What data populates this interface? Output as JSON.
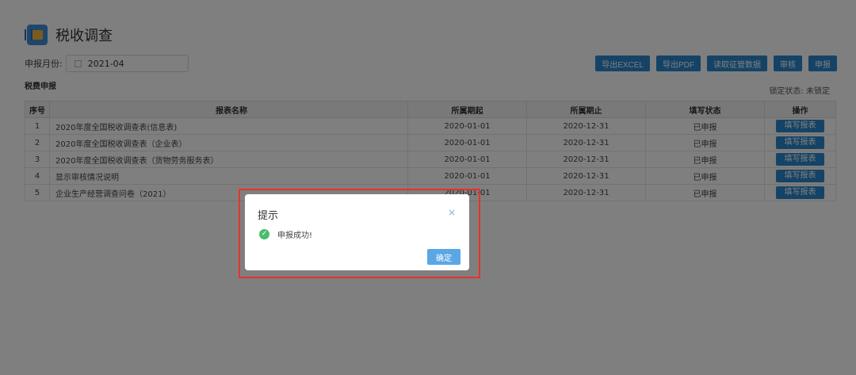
{
  "header": {
    "title": "税收调查",
    "logo": "ledger-book-icon"
  },
  "filter": {
    "month_label": "申报月份:",
    "month_value": "2021-04"
  },
  "toolbar": {
    "export_excel": "导出EXCEL",
    "export_pdf": "导出PDF",
    "read_data": "读取征管数据",
    "review": "审核",
    "submit": "申报"
  },
  "section": {
    "title": "税费申报",
    "lock_status": "锁定状态: 未锁定"
  },
  "table": {
    "headers": {
      "index": "序号",
      "name": "报表名称",
      "period_start": "所属期起",
      "period_end": "所属期止",
      "status": "填写状态",
      "action": "操作"
    },
    "rows": [
      {
        "index": "1",
        "name": "2020年度全国税收调查表(信息表)",
        "start": "2020-01-01",
        "end": "2020-12-31",
        "status": "已申报",
        "action": "填写报表"
      },
      {
        "index": "2",
        "name": "2020年度全国税收调查表（企业表）",
        "start": "2020-01-01",
        "end": "2020-12-31",
        "status": "已申报",
        "action": "填写报表"
      },
      {
        "index": "3",
        "name": "2020年度全国税收调查表（货物劳务服务表）",
        "start": "2020-01-01",
        "end": "2020-12-31",
        "status": "已申报",
        "action": "填写报表"
      },
      {
        "index": "4",
        "name": "显示审核情况说明",
        "start": "2020-01-01",
        "end": "2020-12-31",
        "status": "已申报",
        "action": "填写报表"
      },
      {
        "index": "5",
        "name": "企业生产经营调查问卷（2021）",
        "start": "2020-01-01",
        "end": "2020-12-31",
        "status": "已申报",
        "action": "填写报表"
      }
    ]
  },
  "dialog": {
    "title": "提示",
    "close": "×",
    "icon": "check-circle-icon",
    "message": "申报成功!",
    "ok": "确定"
  },
  "colors": {
    "primary": "#2a86cd",
    "success": "#3db36b",
    "highlight": "#e8322b"
  }
}
